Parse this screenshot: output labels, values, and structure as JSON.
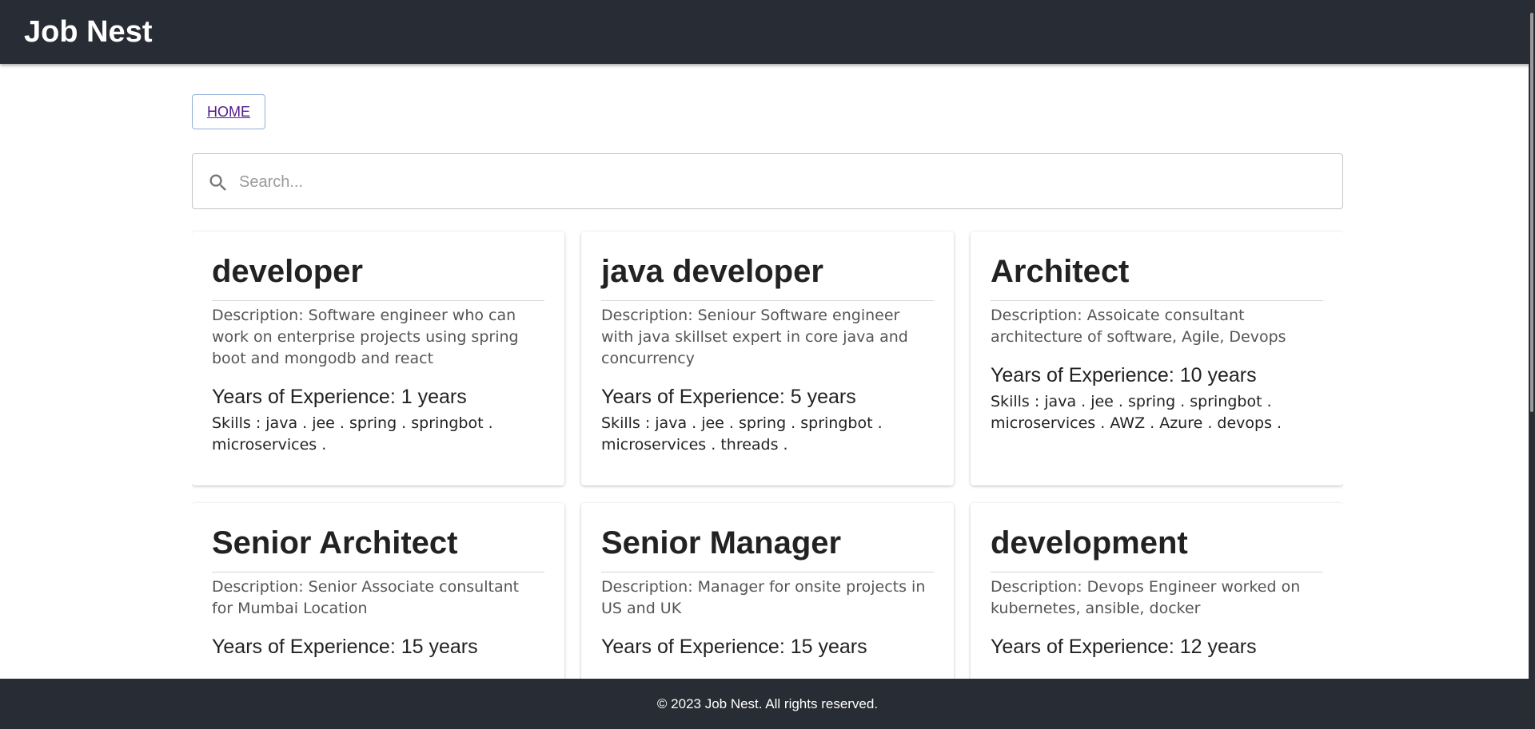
{
  "header": {
    "brand": "Job Nest"
  },
  "nav": {
    "home_label": "HOME"
  },
  "search": {
    "placeholder": "Search...",
    "value": ""
  },
  "jobs": [
    {
      "title": "developer",
      "description": "Description: Software engineer who can work on enterprise projects using spring boot and mongodb and react",
      "experience": "Years of Experience: 1 years",
      "skills": "Skills : java . jee . spring . springbot . microservices ."
    },
    {
      "title": "java developer",
      "description": "Description: Seniour Software engineer with java skillset expert in core java and concurrency",
      "experience": "Years of Experience: 5 years",
      "skills": "Skills : java . jee . spring . springbot . microservices . threads ."
    },
    {
      "title": "Architect",
      "description": "Description: Assoicate consultant architecture of software, Agile, Devops",
      "experience": "Years of Experience: 10 years",
      "skills": "Skills : java . jee . spring . springbot . microservices . AWZ . Azure . devops ."
    },
    {
      "title": "Senior Architect",
      "description": "Description: Senior Associate consultant for Mumbai Location",
      "experience": "Years of Experience: 15 years",
      "skills": ""
    },
    {
      "title": "Senior Manager",
      "description": "Description: Manager for onsite projects in US and UK",
      "experience": "Years of Experience: 15 years",
      "skills": ""
    },
    {
      "title": "development",
      "description": "Description: Devops Engineer worked on kubernetes, ansible, docker",
      "experience": "Years of Experience: 12 years",
      "skills": ""
    }
  ],
  "footer": {
    "text": "© 2023 Job Nest. All rights reserved."
  },
  "colors": {
    "header_bg": "#282c34",
    "footer_bg": "#282c34",
    "home_link": "#551a8b",
    "home_border": "#90aedc"
  },
  "icons": {
    "search": "search-icon"
  }
}
